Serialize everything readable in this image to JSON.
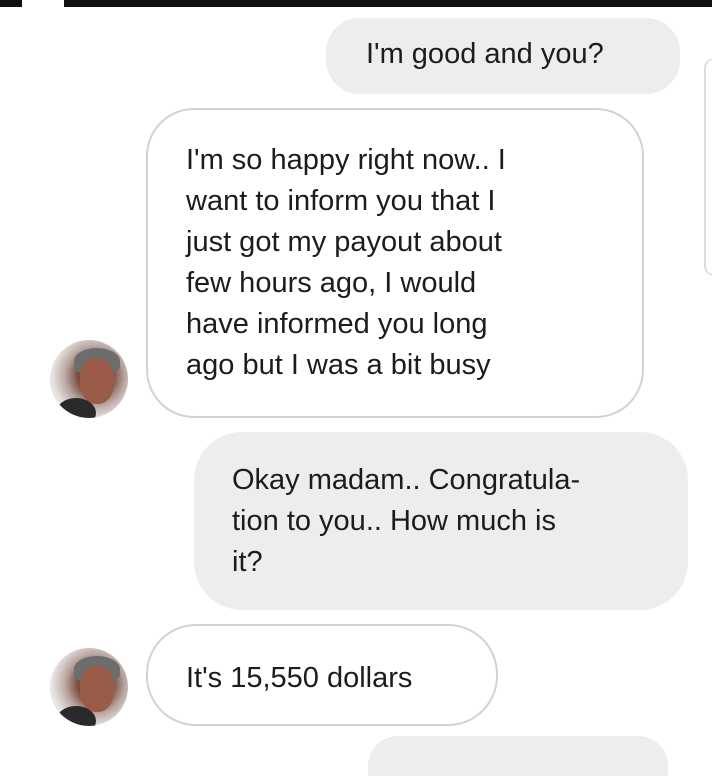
{
  "messages": [
    {
      "direction": "sent",
      "text": "I'm good and you?"
    },
    {
      "direction": "received",
      "lines": [
        "I'm so happy right now.. I",
        "want to inform you that I",
        "just got my payout about",
        "few hours ago, I would",
        "have informed you long",
        "ago but I was a bit busy"
      ]
    },
    {
      "direction": "sent",
      "lines": [
        "Okay madam.. Congratula-",
        "tion to you.. How much is",
        "it?"
      ]
    },
    {
      "direction": "received",
      "text": "It's 15,550 dollars"
    }
  ],
  "contact": {
    "avatar_icon": "contact-avatar-photo"
  },
  "colors": {
    "sent_bubble": "#ededed",
    "received_border": "#d2d2d2",
    "text": "#1c1c1c"
  }
}
